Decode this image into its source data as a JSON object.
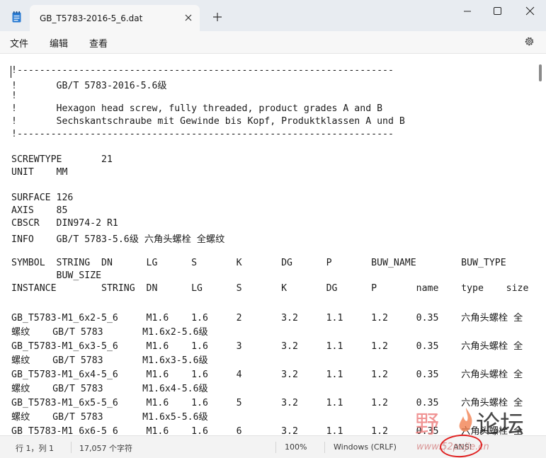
{
  "window": {
    "tab_title": "GB_T5783-2016-5_6.dat",
    "icons": [
      "notepad-icon",
      "close-icon",
      "plus-icon",
      "minimize-icon",
      "maximize-icon",
      "close-icon"
    ]
  },
  "menu": {
    "file": "文件",
    "edit": "编辑",
    "view": "查看",
    "settings_icon": "gear-icon"
  },
  "editor": {
    "lines": [
      "!-------------------------------------------------------------------",
      "!       GB/T 5783-2016-5.6级",
      "!",
      "!       Hexagon head screw, fully threaded, product grades A and B",
      "!       Sechskantschraube mit Gewinde bis Kopf, Produktklassen A und B",
      "!-------------------------------------------------------------------",
      "",
      "SCREWTYPE       21",
      "UNIT    MM",
      "",
      "SURFACE 126",
      "AXIS    85",
      "CBSCR   DIN974-2 R1",
      "INFO    GB/T 5783-5.6级 六角头螺栓 全螺纹",
      "",
      "SYMBOL  STRING  DN      LG      S       K       DG      P       BUW_NAME        BUW_TYPE",
      "        BUW_SIZE",
      "INSTANCE        STRING  DN      LG      S       K       DG      P       name    type    size",
      "",
      "GB_T5783-M1_6x2-5_6     M1.6    1.6     2       3.2     1.1     1.2     0.35    六角头螺栓 全",
      "螺纹    GB/T 5783       M1.6x2-5.6级",
      "GB_T5783-M1_6x3-5_6     M1.6    1.6     3       3.2     1.1     1.2     0.35    六角头螺栓 全",
      "螺纹    GB/T 5783       M1.6x3-5.6级",
      "GB_T5783-M1_6x4-5_6     M1.6    1.6     4       3.2     1.1     1.2     0.35    六角头螺栓 全",
      "螺纹    GB/T 5783       M1.6x4-5.6级",
      "GB_T5783-M1_6x5-5_6     M1.6    1.6     5       3.2     1.1     1.2     0.35    六角头螺栓 全",
      "螺纹    GB/T 5783       M1.6x5-5.6级",
      "GB_T5783-M1_6x6-5_6     M1.6    1.6     6       3.2     1.1     1.2     0.35    六角头螺栓 全"
    ]
  },
  "status": {
    "position": "行 1，列 1",
    "chars": "17,057 个字符",
    "zoom": "100%",
    "line_ending": "Windows (CRLF)",
    "encoding": "ANSI"
  },
  "watermark": {
    "logo_left": "野",
    "logo_right": "论坛",
    "url": "www.52pojie.cn",
    "accent_color": "#e02020"
  }
}
